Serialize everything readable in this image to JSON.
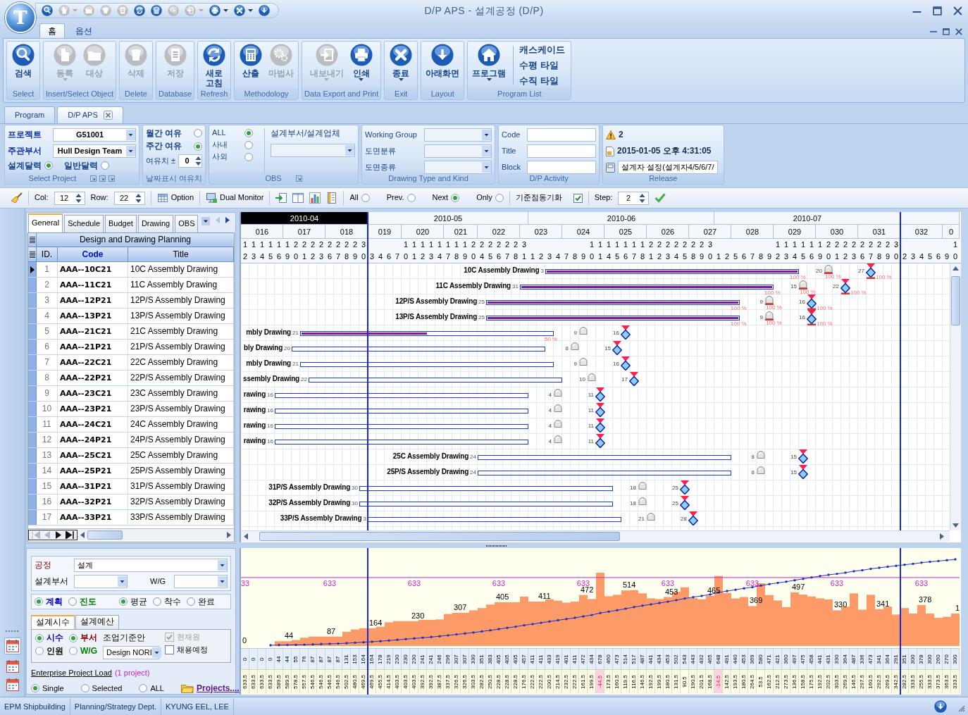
{
  "window": {
    "logo": "T",
    "title": "D/P APS - 설계공정 (D/P)"
  },
  "quick_access": [
    {
      "kind": "search",
      "disabled": false
    },
    {
      "kind": "new",
      "disabled": true,
      "dropdown": true
    },
    {
      "kind": "open",
      "disabled": true
    },
    {
      "kind": "delete",
      "disabled": true
    },
    {
      "kind": "save",
      "disabled": true
    },
    {
      "kind": "refresh",
      "disabled": false
    },
    {
      "kind": "calculator",
      "disabled": false
    },
    {
      "kind": "gears",
      "disabled": true
    },
    {
      "kind": "export",
      "disabled": true,
      "dropdown": true
    },
    {
      "kind": "print",
      "disabled": false,
      "dropdown": true
    },
    {
      "kind": "close",
      "disabled": false,
      "dropdown": true
    },
    {
      "kind": "down",
      "disabled": false
    }
  ],
  "ribbon": {
    "tabs": [
      {
        "label": "홈",
        "selected": true
      },
      {
        "label": "옵션",
        "selected": false
      }
    ],
    "groups": [
      {
        "label": "Select",
        "buttons": [
          {
            "kind": "search",
            "label": "검색",
            "disabled": false
          }
        ]
      },
      {
        "label": "Insert/Select Object",
        "buttons": [
          {
            "kind": "new",
            "label": "등록",
            "disabled": true,
            "dropdown": true
          },
          {
            "kind": "open",
            "label": "대상",
            "disabled": true
          }
        ]
      },
      {
        "label": "Delete",
        "buttons": [
          {
            "kind": "delete",
            "label": "삭제",
            "disabled": true
          }
        ]
      },
      {
        "label": "Database",
        "buttons": [
          {
            "kind": "save",
            "label": "저장",
            "disabled": true
          }
        ]
      },
      {
        "label": "Refresh",
        "buttons": [
          {
            "kind": "refresh",
            "label": "새로 고침",
            "disabled": false
          }
        ]
      },
      {
        "label": "Methodology",
        "buttons": [
          {
            "kind": "calculator",
            "label": "산출",
            "disabled": false
          },
          {
            "kind": "gears",
            "label": "마법사",
            "disabled": true
          }
        ]
      },
      {
        "label": "Data Export and Print",
        "buttons": [
          {
            "kind": "export",
            "label": "내보내기",
            "disabled": true,
            "dropdown": true
          },
          {
            "kind": "print",
            "label": "인쇄",
            "disabled": false,
            "dropdown": true
          }
        ]
      },
      {
        "label": "Exit",
        "buttons": [
          {
            "kind": "close",
            "label": "종료",
            "disabled": false,
            "dropdown": true
          }
        ]
      },
      {
        "label": "Layout",
        "buttons": [
          {
            "kind": "down",
            "label": "아래화면",
            "disabled": false
          }
        ]
      },
      {
        "label": "Program List",
        "buttons": [
          {
            "kind": "home",
            "label": "프로그램",
            "disabled": false,
            "dropdown": true
          }
        ],
        "links": [
          "캐스케이드",
          "수평 타일",
          "수직 타일"
        ]
      }
    ]
  },
  "doc_tabs": [
    {
      "label": "Program",
      "selected": false
    },
    {
      "label": "D/P APS",
      "selected": true,
      "closable": true
    }
  ],
  "filters": {
    "project": {
      "title": "Select Project",
      "fields": [
        {
          "label": "프로젝트",
          "value": "G51001"
        },
        {
          "label": "주관부서",
          "value": "Hull Design Team"
        }
      ],
      "calendars": [
        {
          "label": "설계달력",
          "selected": true
        },
        {
          "label": "일반달력",
          "selected": false
        }
      ]
    },
    "margin": {
      "title": "날짜표시 여유치",
      "options": [
        {
          "label": "월간 여유",
          "selected": false
        },
        {
          "label": "주간 여유",
          "selected": true
        }
      ],
      "spin": {
        "label": "여유치 ±",
        "value": "0"
      }
    },
    "obs": {
      "title": "OBS",
      "options": [
        {
          "label": "ALL",
          "selected": true
        },
        {
          "label": "사내",
          "selected": false
        },
        {
          "label": "사외",
          "selected": false
        }
      ],
      "combo_label": "설계부서/설계업체"
    },
    "drawing": {
      "title": "Drawing Type and Kind",
      "fields": [
        {
          "label": "Working Group"
        },
        {
          "label": "도면분류"
        },
        {
          "label": "도면종류"
        }
      ]
    },
    "activity": {
      "title": "D/P Activity",
      "fields": [
        {
          "label": "Code"
        },
        {
          "label": "Title"
        },
        {
          "label": "Block"
        }
      ]
    },
    "release": {
      "title": "Release",
      "count": "2",
      "date": "2015-01-05 오후 4:31:05",
      "setting": "설계자 설정(설계자4/5/6/7/"
    }
  },
  "toolbar": {
    "col": {
      "label": "Col:",
      "value": "12"
    },
    "row": {
      "label": "Row:",
      "value": "22"
    },
    "buttons": [
      {
        "kind": "option",
        "label": "Option"
      },
      {
        "kind": "monitor",
        "label": "Dual Monitor"
      }
    ],
    "views": [
      {
        "kind": "import"
      },
      {
        "kind": "columns"
      },
      {
        "kind": "chart"
      },
      {
        "kind": "sheet"
      }
    ],
    "nav": [
      {
        "label": "All",
        "selected": false
      },
      {
        "label": "Prev.",
        "selected": false
      },
      {
        "label": "Next",
        "selected": true
      },
      {
        "label": "Only",
        "selected": false
      }
    ],
    "sync": {
      "label": "기준점동기화",
      "checked": true
    },
    "step": {
      "label": "Step:",
      "value": "2"
    }
  },
  "sidebar": {
    "items": [
      {
        "selected": true
      },
      {
        "selected": false
      },
      {
        "selected": false
      }
    ]
  },
  "grid": {
    "tabs": [
      {
        "label": "General",
        "selected": true
      },
      {
        "label": "Schedule",
        "selected": false
      },
      {
        "label": "Budget",
        "selected": false
      },
      {
        "label": "Drawing",
        "selected": false
      },
      {
        "label": "OBS",
        "selected": false
      }
    ],
    "band": "Design and Drawing Planning",
    "columns": [
      {
        "label": "ID.",
        "sorted": false
      },
      {
        "label": "Code",
        "sorted": true
      },
      {
        "label": "Title",
        "sorted": false
      }
    ],
    "rows": [
      {
        "id": "1",
        "code": "AAA--10C21",
        "title": "10C Assembly Drawing",
        "selected": true
      },
      {
        "id": "2",
        "code": "AAA--11C21",
        "title": "11C Assembly Drawing",
        "selected": false
      },
      {
        "id": "3",
        "code": "AAA--12P21",
        "title": "12P/S Assembly Drawing",
        "selected": false
      },
      {
        "id": "4",
        "code": "AAA--13P21",
        "title": "13P/S Assembly Drawing",
        "selected": false
      },
      {
        "id": "5",
        "code": "AAA--21C21",
        "title": "21C Assembly Drawing",
        "selected": false
      },
      {
        "id": "6",
        "code": "AAA--21P21",
        "title": "21P/S Assembly Drawing",
        "selected": false
      },
      {
        "id": "7",
        "code": "AAA--22C21",
        "title": "22C Assembly Drawing",
        "selected": false
      },
      {
        "id": "8",
        "code": "AAA--22P21",
        "title": "22P/S Assembly Drawing",
        "selected": false
      },
      {
        "id": "9",
        "code": "AAA--23C21",
        "title": "23C Assembly Drawing",
        "selected": false
      },
      {
        "id": "10",
        "code": "AAA--23P21",
        "title": "23P/S Assembly Drawing",
        "selected": false
      },
      {
        "id": "11",
        "code": "AAA--24C21",
        "title": "24C Assembly Drawing",
        "selected": false
      },
      {
        "id": "12",
        "code": "AAA--24P21",
        "title": "24P/S Assembly Drawing",
        "selected": false
      },
      {
        "id": "13",
        "code": "AAA--25C21",
        "title": "25C Assembly Drawing",
        "selected": false
      },
      {
        "id": "14",
        "code": "AAA--25P21",
        "title": "25P/S Assembly Drawing",
        "selected": false
      },
      {
        "id": "15",
        "code": "AAA--31P21",
        "title": "31P/S Assembly Drawing",
        "selected": false
      },
      {
        "id": "16",
        "code": "AAA--32P21",
        "title": "32P/S Assembly Drawing",
        "selected": false
      },
      {
        "id": "17",
        "code": "AAA--33P21",
        "title": "33P/S Assembly Drawing",
        "selected": false
      }
    ]
  },
  "timeline": {
    "months": [
      {
        "label": "2010-04",
        "selected": true
      },
      {
        "label": "2010-05",
        "selected": false
      },
      {
        "label": "2010-06",
        "selected": false
      },
      {
        "label": "2010-07",
        "selected": false
      }
    ],
    "weeks": [
      {
        "label": "016",
        "days": [
          {
            "tens": "1",
            "units": "2"
          },
          {
            "tens": "1",
            "units": "3"
          },
          {
            "tens": "1",
            "units": "4"
          },
          {
            "tens": "1",
            "units": "5"
          },
          {
            "tens": "1",
            "units": "6"
          }
        ]
      },
      {
        "label": "017",
        "days": [
          {
            "tens": "1",
            "units": "9"
          },
          {
            "tens": "2",
            "units": "0"
          },
          {
            "tens": "2",
            "units": "1"
          },
          {
            "tens": "2",
            "units": "2"
          },
          {
            "tens": "2",
            "units": "3"
          }
        ]
      },
      {
        "label": "018",
        "days": [
          {
            "tens": "2",
            "units": "6"
          },
          {
            "tens": "2",
            "units": "7"
          },
          {
            "tens": "2",
            "units": "8"
          },
          {
            "tens": "2",
            "units": "9"
          },
          {
            "tens": "3",
            "units": "0"
          }
        ]
      },
      {
        "label": "019",
        "days": [
          {
            "units": "3"
          },
          {
            "units": "4"
          },
          {
            "units": "6"
          },
          {
            "units": "7"
          }
        ]
      },
      {
        "label": "020",
        "days": [
          {
            "tens": "1",
            "units": "0"
          },
          {
            "tens": "1",
            "units": "1"
          },
          {
            "tens": "1",
            "units": "2"
          },
          {
            "tens": "1",
            "units": "3"
          },
          {
            "tens": "1",
            "units": "4"
          }
        ]
      },
      {
        "label": "021",
        "days": [
          {
            "tens": "1",
            "units": "7"
          },
          {
            "tens": "1",
            "units": "8"
          },
          {
            "tens": "1",
            "units": "9"
          },
          {
            "tens": "2",
            "units": "0"
          }
        ]
      },
      {
        "label": "022",
        "days": [
          {
            "tens": "2",
            "units": "4"
          },
          {
            "tens": "2",
            "units": "5"
          },
          {
            "tens": "2",
            "units": "6"
          },
          {
            "tens": "2",
            "units": "7"
          },
          {
            "tens": "2",
            "units": "8"
          }
        ]
      },
      {
        "label": "023",
        "days": [
          {
            "tens": "3",
            "units": "1"
          },
          {
            "units": "1"
          },
          {
            "units": "2"
          },
          {
            "units": "3"
          },
          {
            "units": "4"
          }
        ]
      },
      {
        "label": "024",
        "days": [
          {
            "units": "7"
          },
          {
            "units": "8"
          },
          {
            "units": "9"
          },
          {
            "tens": "1",
            "units": "0"
          },
          {
            "tens": "1",
            "units": "1"
          }
        ]
      },
      {
        "label": "025",
        "days": [
          {
            "tens": "1",
            "units": "4"
          },
          {
            "tens": "1",
            "units": "5"
          },
          {
            "tens": "1",
            "units": "6"
          },
          {
            "tens": "1",
            "units": "7"
          },
          {
            "tens": "1",
            "units": "8"
          }
        ]
      },
      {
        "label": "026",
        "days": [
          {
            "tens": "2",
            "units": "1"
          },
          {
            "tens": "2",
            "units": "2"
          },
          {
            "tens": "2",
            "units": "3"
          },
          {
            "tens": "2",
            "units": "4"
          },
          {
            "tens": "2",
            "units": "5"
          }
        ]
      },
      {
        "label": "027",
        "days": [
          {
            "tens": "2",
            "units": "8"
          },
          {
            "tens": "2",
            "units": "9"
          },
          {
            "tens": "3",
            "units": "0"
          },
          {
            "units": "1"
          },
          {
            "units": "2"
          }
        ]
      },
      {
        "label": "028",
        "days": [
          {
            "units": "5"
          },
          {
            "units": "6"
          },
          {
            "units": "7"
          },
          {
            "units": "8"
          },
          {
            "units": "9"
          }
        ]
      },
      {
        "label": "029",
        "days": [
          {
            "tens": "1",
            "units": "2"
          },
          {
            "tens": "1",
            "units": "3"
          },
          {
            "tens": "1",
            "units": "4"
          },
          {
            "tens": "1",
            "units": "5"
          },
          {
            "tens": "1",
            "units": "6"
          }
        ]
      },
      {
        "label": "030",
        "days": [
          {
            "tens": "1",
            "units": "9"
          },
          {
            "tens": "2",
            "units": "0"
          },
          {
            "tens": "2",
            "units": "1"
          },
          {
            "tens": "2",
            "units": "2"
          },
          {
            "tens": "2",
            "units": "3"
          }
        ]
      },
      {
        "label": "031",
        "days": [
          {
            "tens": "2",
            "units": "6"
          },
          {
            "tens": "2",
            "units": "7"
          },
          {
            "tens": "2",
            "units": "8"
          },
          {
            "tens": "2",
            "units": "9"
          },
          {
            "tens": "3",
            "units": "0"
          }
        ]
      },
      {
        "label": "032",
        "days": [
          {
            "units": "2"
          },
          {
            "units": "3"
          },
          {
            "units": "4"
          },
          {
            "units": "5"
          },
          {
            "units": "6"
          }
        ]
      },
      {
        "label": "0",
        "days": [
          {
            "units": "9"
          },
          {
            "tens": "1",
            "units": "0"
          }
        ]
      }
    ]
  },
  "gantt": {
    "rows": [
      {
        "label": "10C Assembly Drawing",
        "start_label": "3",
        "level": 1,
        "progress_label": "100 %",
        "check": {
          "label": "20",
          "completed": true,
          "progress_label": "100 %"
        },
        "milestone": {
          "label": "27",
          "completed": true,
          "progress_label": "100 %"
        }
      },
      {
        "label": "11C Assembly Drawing",
        "start_label": "31",
        "level": 1,
        "progress_label": "100 %",
        "check": {
          "label": "15",
          "completed": true,
          "progress_label": "100 %"
        },
        "milestone": {
          "label": "22",
          "completed": true,
          "progress_label": "100 %"
        }
      },
      {
        "label": "12P/S Assembly Drawing",
        "start_label": "25",
        "level": 1,
        "progress_label": "100 %",
        "check": {
          "label": "9",
          "completed": true,
          "progress_label": "100 %"
        },
        "milestone": {
          "label": "16",
          "completed": true,
          "progress_label": "100 %"
        }
      },
      {
        "label": "13P/S Assembly Drawing",
        "start_label": "25",
        "level": 1,
        "progress_label": "100 %",
        "check": {
          "label": "9",
          "completed": true,
          "progress_label": "100 %"
        },
        "milestone": {
          "label": "16",
          "completed": true,
          "progress_label": "100 %"
        }
      },
      {
        "label": "mbly Drawing",
        "start_label": "21",
        "level": 0.5,
        "progress_label": "50 %",
        "check": {
          "label": "9",
          "completed": false
        },
        "milestone": {
          "label": "16",
          "completed": false
        }
      },
      {
        "label": "bly Drawing",
        "start_label": "20",
        "check": {
          "label": "8",
          "completed": false
        },
        "milestone": {
          "label": "15",
          "completed": false
        }
      },
      {
        "label": "mbly Drawing",
        "start_label": "21",
        "check": {
          "label": "9",
          "completed": false
        },
        "milestone": {
          "label": "16",
          "completed": false
        }
      },
      {
        "label": "ssembly Drawing",
        "start_label": "22",
        "check": {
          "label": "10",
          "completed": false
        },
        "milestone": {
          "label": "17",
          "completed": false
        }
      },
      {
        "label": "rawing",
        "start_label": "16",
        "check": {
          "label": "4",
          "completed": false
        },
        "milestone": {
          "label": "11",
          "completed": false
        }
      },
      {
        "label": "rawing",
        "start_label": "16",
        "check": {
          "label": "4",
          "completed": false
        },
        "milestone": {
          "label": "11",
          "completed": false
        }
      },
      {
        "label": "rawing",
        "start_label": "16",
        "check": {
          "label": "4",
          "completed": false
        },
        "milestone": {
          "label": "11",
          "completed": false
        }
      },
      {
        "label": "rawing",
        "start_label": "16",
        "check": {
          "label": "4",
          "completed": false
        },
        "milestone": {
          "label": "11",
          "completed": false
        }
      },
      {
        "label": "25C Assembly Drawing",
        "start_label": "24",
        "check": {
          "label": "8",
          "completed": false
        },
        "milestone": {
          "label": "15",
          "completed": false
        }
      },
      {
        "label": "25P/S Assembly Drawing",
        "start_label": "24",
        "check": {
          "label": "8",
          "completed": false
        },
        "milestone": {
          "label": "15",
          "completed": false
        }
      },
      {
        "label": "31P/S Assembly Drawing",
        "start_label": "30",
        "check": {
          "label": "18",
          "completed": false
        },
        "milestone": {
          "label": "25",
          "completed": false
        }
      },
      {
        "label": "32P/S Assembly Drawing",
        "start_label": "30",
        "check": {
          "label": "18",
          "completed": false
        },
        "milestone": {
          "label": "25",
          "completed": false
        }
      },
      {
        "label": "33P/S Assembly Drawing",
        "start_label": "3",
        "check": {
          "label": "21",
          "completed": false
        },
        "milestone": {
          "label": "28",
          "completed": false
        }
      }
    ]
  },
  "load": {
    "process": {
      "label": "공정",
      "value": "설계"
    },
    "dept_label": "설계부서",
    "wg_label": "W/G",
    "plan": [
      {
        "label": "계획",
        "selected": true,
        "color": "#0000cc"
      },
      {
        "label": "진도",
        "selected": false,
        "color": "#008000"
      }
    ],
    "basis": [
      {
        "label": "평균",
        "selected": true
      },
      {
        "label": "착수",
        "selected": false
      },
      {
        "label": "완료",
        "selected": false
      }
    ],
    "tabs": [
      {
        "label": "설계시수",
        "selected": true
      },
      {
        "label": "설계예산",
        "selected": false
      }
    ],
    "units": [
      {
        "label": "시수",
        "selected": true,
        "color": "#0000cc"
      },
      {
        "label": "인원",
        "selected": false,
        "color": "#000000"
      }
    ],
    "groups": [
      {
        "label": "부서",
        "selected": true,
        "color": "#800000"
      },
      {
        "label": "W/G",
        "selected": false,
        "color": "#008000"
      }
    ],
    "standard": {
      "label": "조업기준안",
      "value": "Design NORI"
    },
    "checks": [
      {
        "label": "현재원",
        "checked": true,
        "disabled": true
      },
      {
        "label": "채용예정",
        "checked": false,
        "disabled": false
      }
    ],
    "enterprise": {
      "label": "Enterprise Project Load",
      "note": "(1 project)"
    },
    "scope": [
      {
        "label": "Single",
        "selected": true
      },
      {
        "label": "Selected",
        "selected": false
      },
      {
        "label": "ALL",
        "selected": false
      }
    ],
    "projects": "Projects...."
  },
  "chart": {
    "capacity_labels": [
      "33",
      "633",
      "633",
      "633",
      "633",
      "633",
      "633",
      "633",
      "633"
    ],
    "value_labels": [
      "0",
      "44",
      "87",
      "164",
      "230",
      "307",
      "405",
      "411",
      "472",
      "514",
      "453",
      "465",
      "369",
      "497",
      "330",
      "341",
      "378",
      "1"
    ],
    "strip": {
      "load": [
        "0",
        "0",
        "0",
        "0",
        "44",
        "44",
        "55",
        "76",
        "87",
        "87",
        "87",
        "87",
        "131",
        "153",
        "164",
        "164",
        "178",
        "219",
        "230",
        "230",
        "230",
        "241",
        "241",
        "246",
        "296",
        "307",
        "307",
        "330",
        "351",
        "383",
        "405",
        "405",
        "405",
        "457",
        "411",
        "411",
        "433",
        "419",
        "401",
        "411",
        "472",
        "434",
        "678",
        "460",
        "473",
        "514",
        "517",
        "487",
        "441",
        "434",
        "453",
        "502",
        "543",
        "443",
        "432",
        "465",
        "648",
        "491",
        "440",
        "453",
        "369",
        "580",
        "471",
        "421",
        "360",
        "497",
        "475",
        "458",
        "441",
        "431",
        "330",
        "364",
        "487",
        "336",
        "473",
        "341",
        "364",
        "291",
        "351",
        "300",
        "378",
        "300",
        "260",
        "270",
        "300"
      ],
      "remaining": [
        {
          "text": "633.5",
          "over": false
        },
        {
          "text": "633.5",
          "over": false
        },
        {
          "text": "633.5",
          "over": false
        },
        {
          "text": "633.5",
          "over": false
        },
        {
          "text": "589.5",
          "over": false
        },
        {
          "text": "589.5",
          "over": false
        },
        {
          "text": "578.5",
          "over": false
        },
        {
          "text": "557.5",
          "over": false
        },
        {
          "text": "546.5",
          "over": false
        },
        {
          "text": "546.5",
          "over": false
        },
        {
          "text": "546.5",
          "over": false
        },
        {
          "text": "546.5",
          "over": false
        },
        {
          "text": "502.5",
          "over": false
        },
        {
          "text": "480.5",
          "over": false
        },
        {
          "text": "469.5",
          "over": false
        },
        {
          "text": "469.5",
          "over": false
        },
        {
          "text": "455.5",
          "over": false
        },
        {
          "text": "414.5",
          "over": false
        },
        {
          "text": "403.5",
          "over": false
        },
        {
          "text": "403.5",
          "over": false
        },
        {
          "text": "403.5",
          "over": false
        },
        {
          "text": "392.5",
          "over": false
        },
        {
          "text": "392.5",
          "over": false
        },
        {
          "text": "387.5",
          "over": false
        },
        {
          "text": "337.5",
          "over": false
        },
        {
          "text": "326.5",
          "over": false
        },
        {
          "text": "326.5",
          "over": false
        },
        {
          "text": "303.5",
          "over": false
        },
        {
          "text": "282.5",
          "over": false
        },
        {
          "text": "250.5",
          "over": false
        },
        {
          "text": "228.5",
          "over": false
        },
        {
          "text": "228.5",
          "over": false
        },
        {
          "text": "228.5",
          "over": false
        },
        {
          "text": "176.5",
          "over": false
        },
        {
          "text": "222.5",
          "over": false
        },
        {
          "text": "222.5",
          "over": false
        },
        {
          "text": "200.5",
          "over": false
        },
        {
          "text": "214.5",
          "over": false
        },
        {
          "text": "232.5",
          "over": false
        },
        {
          "text": "222.5",
          "over": false
        },
        {
          "text": "161.5",
          "over": false
        },
        {
          "text": "199.5",
          "over": false
        },
        {
          "text": "-44.5",
          "over": true
        },
        {
          "text": "173.5",
          "over": false
        },
        {
          "text": "160.5",
          "over": false
        },
        {
          "text": "119.5",
          "over": false
        },
        {
          "text": "116.5",
          "over": false
        },
        {
          "text": "146.5",
          "over": false
        },
        {
          "text": "192.5",
          "over": false
        },
        {
          "text": "199.5",
          "over": false
        },
        {
          "text": "180.5",
          "over": false
        },
        {
          "text": "131.5",
          "over": false
        },
        {
          "text": "90.5",
          "over": false
        },
        {
          "text": "190.5",
          "over": false
        },
        {
          "text": "201.5",
          "over": false
        },
        {
          "text": "168.5",
          "over": false
        },
        {
          "text": "-14.5",
          "over": true
        },
        {
          "text": "142.5",
          "over": false
        },
        {
          "text": "193.5",
          "over": false
        },
        {
          "text": "180.5",
          "over": false
        },
        {
          "text": "264.5",
          "over": false
        },
        {
          "text": "53.5",
          "over": false
        },
        {
          "text": "162.5",
          "over": false
        },
        {
          "text": "212.5",
          "over": false
        },
        {
          "text": "273.5",
          "over": false
        },
        {
          "text": "136.5",
          "over": false
        },
        {
          "text": "158.5",
          "over": false
        },
        {
          "text": "175.5",
          "over": false
        },
        {
          "text": "192.5",
          "over": false
        },
        {
          "text": "202.5",
          "over": false
        },
        {
          "text": "303.5",
          "over": false
        },
        {
          "text": "269.5",
          "over": false
        },
        {
          "text": "146.5",
          "over": false
        },
        {
          "text": "297.5",
          "over": false
        },
        {
          "text": "160.5",
          "over": false
        },
        {
          "text": "292.5",
          "over": false
        },
        {
          "text": "269.5",
          "over": false
        },
        {
          "text": "342.5",
          "over": false
        },
        {
          "text": "282.5",
          "over": false
        },
        {
          "text": "333.5",
          "over": false
        },
        {
          "text": "255.5",
          "over": false
        },
        {
          "text": "333.5",
          "over": false
        },
        {
          "text": "373.5",
          "over": false
        },
        {
          "text": "363.5",
          "over": false
        },
        {
          "text": "333.5",
          "over": false
        }
      ]
    }
  },
  "status_bar": [
    "EPM Shipbuilding",
    "Planning/Strategy Dept.",
    "KYUNG EEL, LEE"
  ]
}
